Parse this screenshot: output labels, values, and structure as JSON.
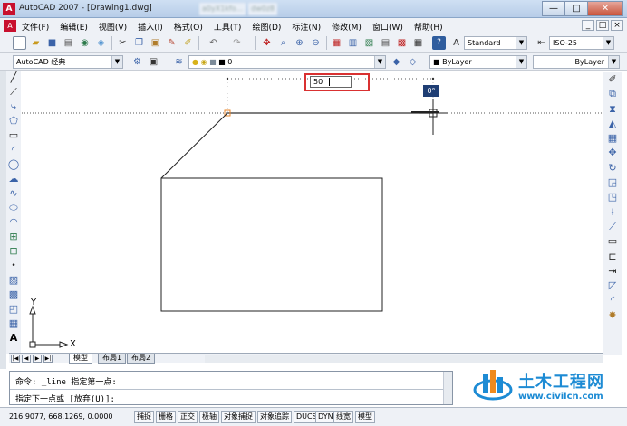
{
  "window": {
    "title": "AutoCAD 2007 - [Drawing1.dwg]",
    "blurred_title_parts": [
      "a0yX1kfo...",
      "dw0z8"
    ],
    "minimize": "—",
    "maximize": "□",
    "close": "✕"
  },
  "menu": {
    "items": [
      "文件(F)",
      "编辑(E)",
      "视图(V)",
      "插入(I)",
      "格式(O)",
      "工具(T)",
      "绘图(D)",
      "标注(N)",
      "修改(M)",
      "窗口(W)",
      "帮助(H)"
    ],
    "mdi_min": "_",
    "mdi_max": "□",
    "mdi_close": "×"
  },
  "toolbar1": {
    "text_style": "Standard",
    "dim_style": "ISO-25"
  },
  "toolbar2": {
    "workspace": "AutoCAD 经典",
    "layer": "0",
    "color": "ByLayer",
    "linetype": "ByLayer"
  },
  "canvas": {
    "dynamic_input_value": "50",
    "angle_tooltip": "0°",
    "ucs_x_label": "X",
    "ucs_y_label": "Y"
  },
  "tabs": {
    "items": [
      "模型",
      "布局1",
      "布局2"
    ],
    "active": "模型"
  },
  "command": {
    "line1": "命令: _line 指定第一点:",
    "line2": "指定下一点或 [放弃(U)]:"
  },
  "watermark": {
    "title": "土木工程网",
    "url": "www.civilcn.com"
  },
  "status": {
    "coords": "216.9077,  668.1269,  0.0000",
    "buttons": [
      "捕捉",
      "栅格",
      "正交",
      "极轴",
      "对象捕捉",
      "对象追踪",
      "DUCS",
      "DYN",
      "线宽",
      "模型"
    ]
  },
  "colors": {
    "highlight_box": "#d93131",
    "angle_tooltip_bg": "#1f3e74",
    "watermark_blue": "#1d8bd4",
    "grip_orange": "#e8862a"
  }
}
